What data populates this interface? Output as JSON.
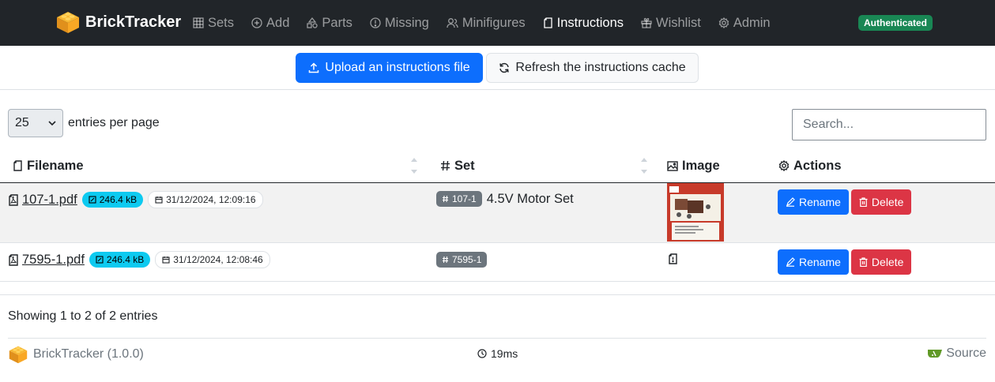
{
  "navbar": {
    "brand": "BrickTracker",
    "items": [
      {
        "label": "Sets",
        "icon": "grid-icon"
      },
      {
        "label": "Add",
        "icon": "plus-circle-icon"
      },
      {
        "label": "Parts",
        "icon": "shapes-icon"
      },
      {
        "label": "Missing",
        "icon": "error-circle-icon"
      },
      {
        "label": "Minifigures",
        "icon": "group-icon"
      },
      {
        "label": "Instructions",
        "icon": "file-icon"
      },
      {
        "label": "Wishlist",
        "icon": "gift-icon"
      },
      {
        "label": "Admin",
        "icon": "cog-icon"
      }
    ],
    "active": "Instructions",
    "auth_badge": "Authenticated"
  },
  "toolbar": {
    "upload_label": "Upload an instructions file",
    "refresh_label": "Refresh the instructions cache"
  },
  "table_controls": {
    "page_size": "25",
    "entries_label": "entries per page",
    "search_placeholder": "Search..."
  },
  "table": {
    "columns": [
      "Filename",
      "Set",
      "Image",
      "Actions"
    ],
    "rows": [
      {
        "filename": "107-1.pdf",
        "size": "246.4 kB",
        "date": "31/12/2024, 12:09:16",
        "set_id": "107-1",
        "set_name": "4.5V Motor Set",
        "has_image": true,
        "rename": "Rename",
        "delete": "Delete"
      },
      {
        "filename": "7595-1.pdf",
        "size": "246.4 kB",
        "date": "31/12/2024, 12:08:46",
        "set_id": "7595-1",
        "set_name": "",
        "has_image": false,
        "rename": "Rename",
        "delete": "Delete"
      }
    ]
  },
  "showing": "Showing 1 to 2 of 2 entries",
  "footer": {
    "brand": "BrickTracker (1.0.0)",
    "timing": "19ms",
    "source": "Source"
  },
  "colors": {
    "navbar_bg": "#212529",
    "primary": "#0d6efd",
    "danger": "#dc3545",
    "info": "#0dcaf0",
    "success": "#198754",
    "secondary": "#6c757d"
  }
}
